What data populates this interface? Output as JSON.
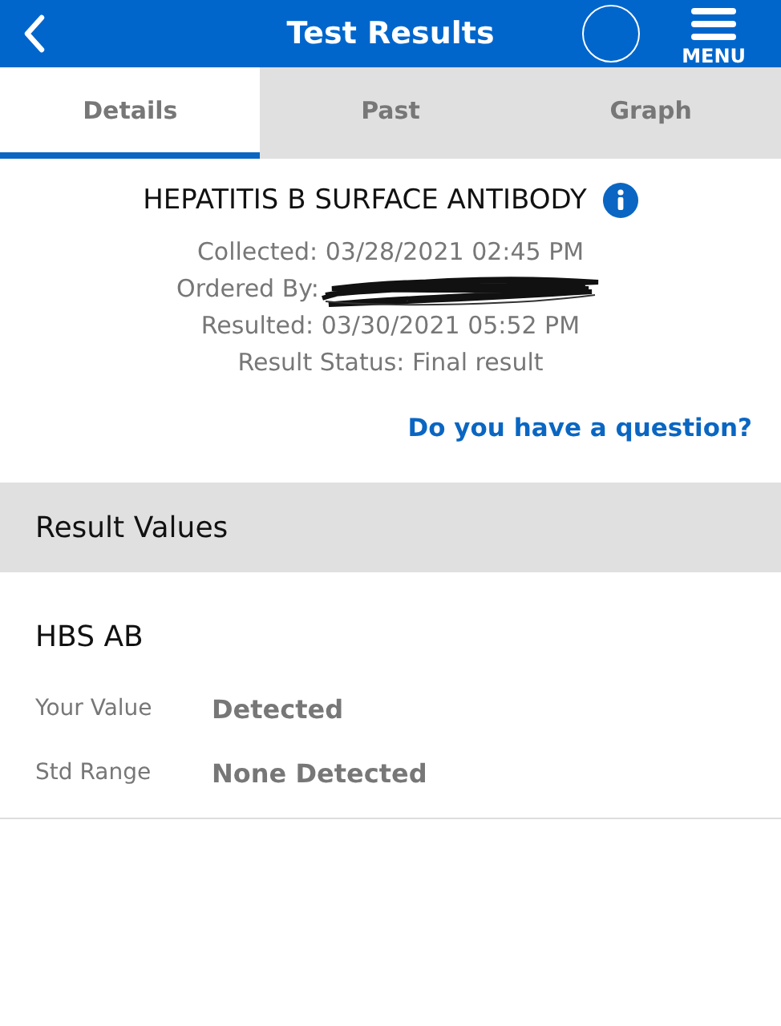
{
  "header": {
    "title": "Test Results",
    "menu_label": "MENU"
  },
  "tabs": [
    {
      "label": "Details",
      "selected": true
    },
    {
      "label": "Past",
      "selected": false
    },
    {
      "label": "Graph",
      "selected": false
    }
  ],
  "test": {
    "name": "HEPATITIS B SURFACE ANTIBODY",
    "details": [
      "Collected: 03/28/2021 02:45 PM",
      "Ordered By:",
      "Resulted: 03/30/2021 05:52 PM",
      "Result Status: Final result"
    ],
    "question_link": "Do you have a question?"
  },
  "section_title": "Result Values",
  "result": {
    "name": "HBS AB",
    "rows": [
      {
        "label": "Your Value",
        "value": "Detected"
      },
      {
        "label": "Std Range",
        "value": "None Detected"
      }
    ]
  }
}
